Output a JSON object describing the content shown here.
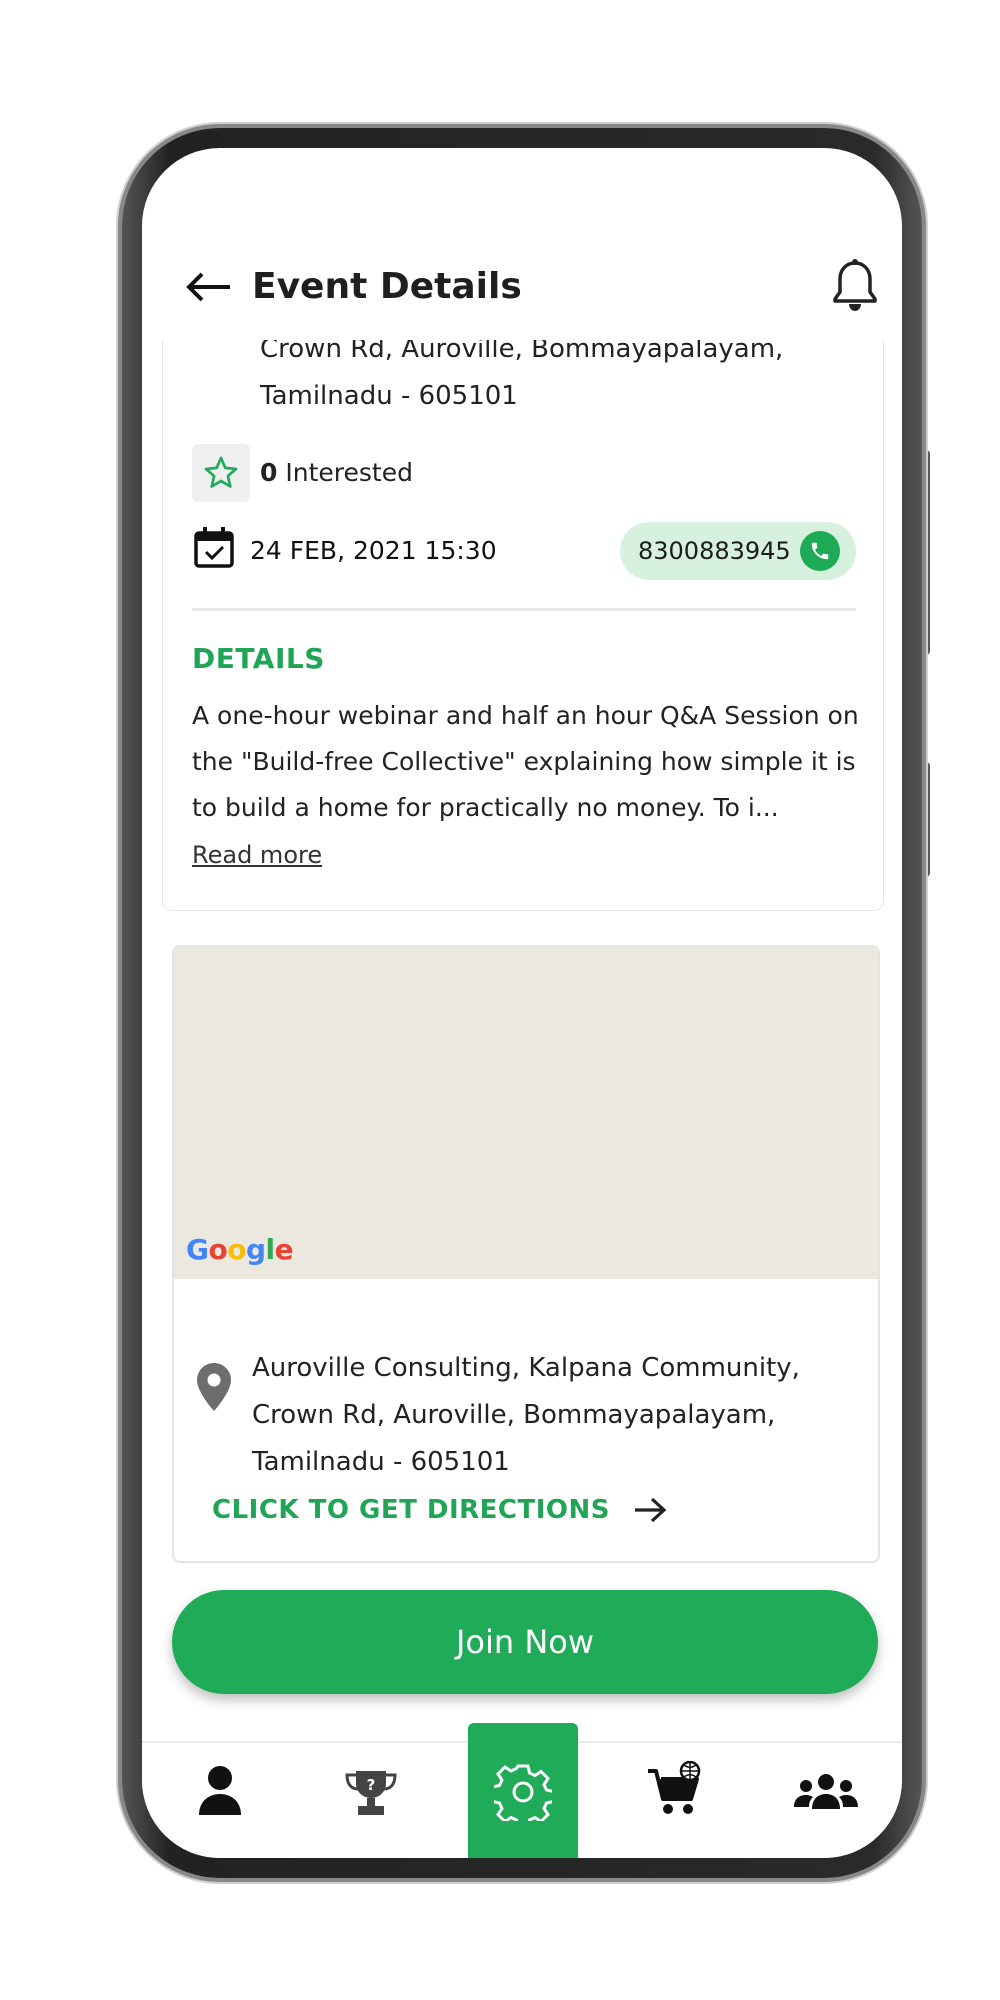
{
  "header": {
    "title": "Event Details",
    "back_icon": "arrow-left-icon",
    "notification_icon": "bell-icon"
  },
  "event": {
    "address_lines": [
      "Crown Rd, Auroville, Bommayapalayam,",
      "Tamilnadu - 605101"
    ],
    "interested_count": "0",
    "interested_label": "Interested",
    "datetime": "24 FEB, 2021 15:30",
    "phone": "8300883945"
  },
  "details": {
    "heading": "DETAILS",
    "body": "A one-hour webinar and half an hour Q&A Session on the \"Build-free Collective\" explaining how simple it is to build a home for practically no money. To i...",
    "read_more": "Read more"
  },
  "location": {
    "map_logo": "Google",
    "address_lines": [
      "Auroville Consulting, Kalpana Community,",
      "Crown Rd, Auroville, Bommayapalayam,",
      "Tamilnadu - 605101"
    ],
    "directions_label": "CLICK TO GET DIRECTIONS"
  },
  "cta": {
    "join_label": "Join Now"
  },
  "bottom_nav": {
    "items": [
      {
        "icon": "person-icon",
        "active": false
      },
      {
        "icon": "trophy-question-icon",
        "active": false
      },
      {
        "icon": "gear-icon",
        "active": true
      },
      {
        "icon": "shopping-cart-icon",
        "active": false
      },
      {
        "icon": "group-icon",
        "active": false
      }
    ]
  },
  "colors": {
    "accent": "#1fab57",
    "accent_text": "#20a455",
    "phone_chip_bg": "#d6f1de",
    "map_bg": "#ebe8e0"
  }
}
